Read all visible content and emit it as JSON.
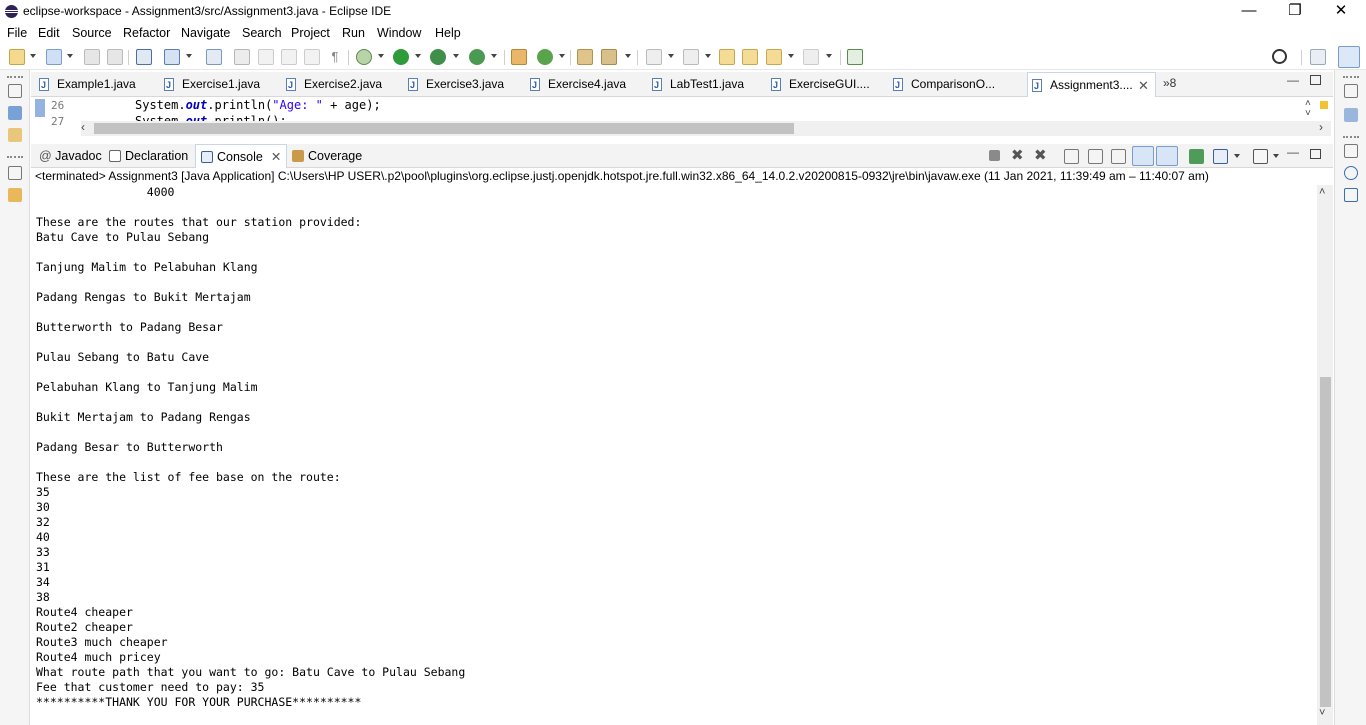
{
  "window": {
    "title": "eclipse-workspace - Assignment3/src/Assignment3.java - Eclipse IDE",
    "minimize": "—",
    "restore": "❐",
    "close": "✕"
  },
  "menu": [
    "File",
    "Edit",
    "Source",
    "Refactor",
    "Navigate",
    "Search",
    "Project",
    "Run",
    "Window",
    "Help"
  ],
  "editor_tabs": [
    {
      "label": "Example1.java"
    },
    {
      "label": "Exercise1.java"
    },
    {
      "label": "Exercise2.java"
    },
    {
      "label": "Exercise3.java"
    },
    {
      "label": "Exercise4.java"
    },
    {
      "label": "LabTest1.java"
    },
    {
      "label": "ExerciseGUI...."
    },
    {
      "label": "ComparisonO..."
    },
    {
      "label": "Assignment3...."
    }
  ],
  "editor_overflow": "»8",
  "editor": {
    "line26_no": "26",
    "line27_no": "27",
    "line26_pre": "System.",
    "line26_out": "out",
    "line26_mid": ".println(",
    "line26_str": "\"Age: \"",
    "line26_post": " + age);",
    "line27_pre": "System.",
    "line27_out": "out",
    "line27_post": ".println();"
  },
  "view_tabs": {
    "javadoc": "Javadoc",
    "declaration": "Declaration",
    "console": "Console",
    "coverage": "Coverage"
  },
  "console_status": "<terminated> Assignment3 [Java Application] C:\\Users\\HP USER\\.p2\\pool\\plugins\\org.eclipse.justj.openjdk.hotspot.jre.full.win32.x86_64_14.0.2.v20200815-0932\\jre\\bin\\javaw.exe  (11 Jan 2021, 11:39:49 am – 11:40:07 am)",
  "console_lines": [
    "                4000",
    "",
    "These are the routes that our station provided:",
    "Batu Cave to Pulau Sebang",
    "",
    "Tanjung Malim to Pelabuhan Klang",
    "",
    "Padang Rengas to Bukit Mertajam",
    "",
    "Butterworth to Padang Besar",
    "",
    "Pulau Sebang to Batu Cave",
    "",
    "Pelabuhan Klang to Tanjung Malim",
    "",
    "Bukit Mertajam to Padang Rengas",
    "",
    "Padang Besar to Butterworth",
    "",
    "These are the list of fee base on the route:",
    "35",
    "30",
    "32",
    "40",
    "33",
    "31",
    "34",
    "38",
    "Route4 cheaper",
    "Route2 cheaper",
    "Route3 much cheaper",
    "Route4 much pricey",
    "What route path that you want to go: Batu Cave to Pulau Sebang",
    "Fee that customer need to pay: 35",
    "**********THANK YOU FOR YOUR PURCHASE**********"
  ],
  "colors": {
    "accent": "#c8d6e6",
    "java_keyword": "#0000c0",
    "java_string": "#2a00ff",
    "run_green": "#2e9c3a"
  }
}
